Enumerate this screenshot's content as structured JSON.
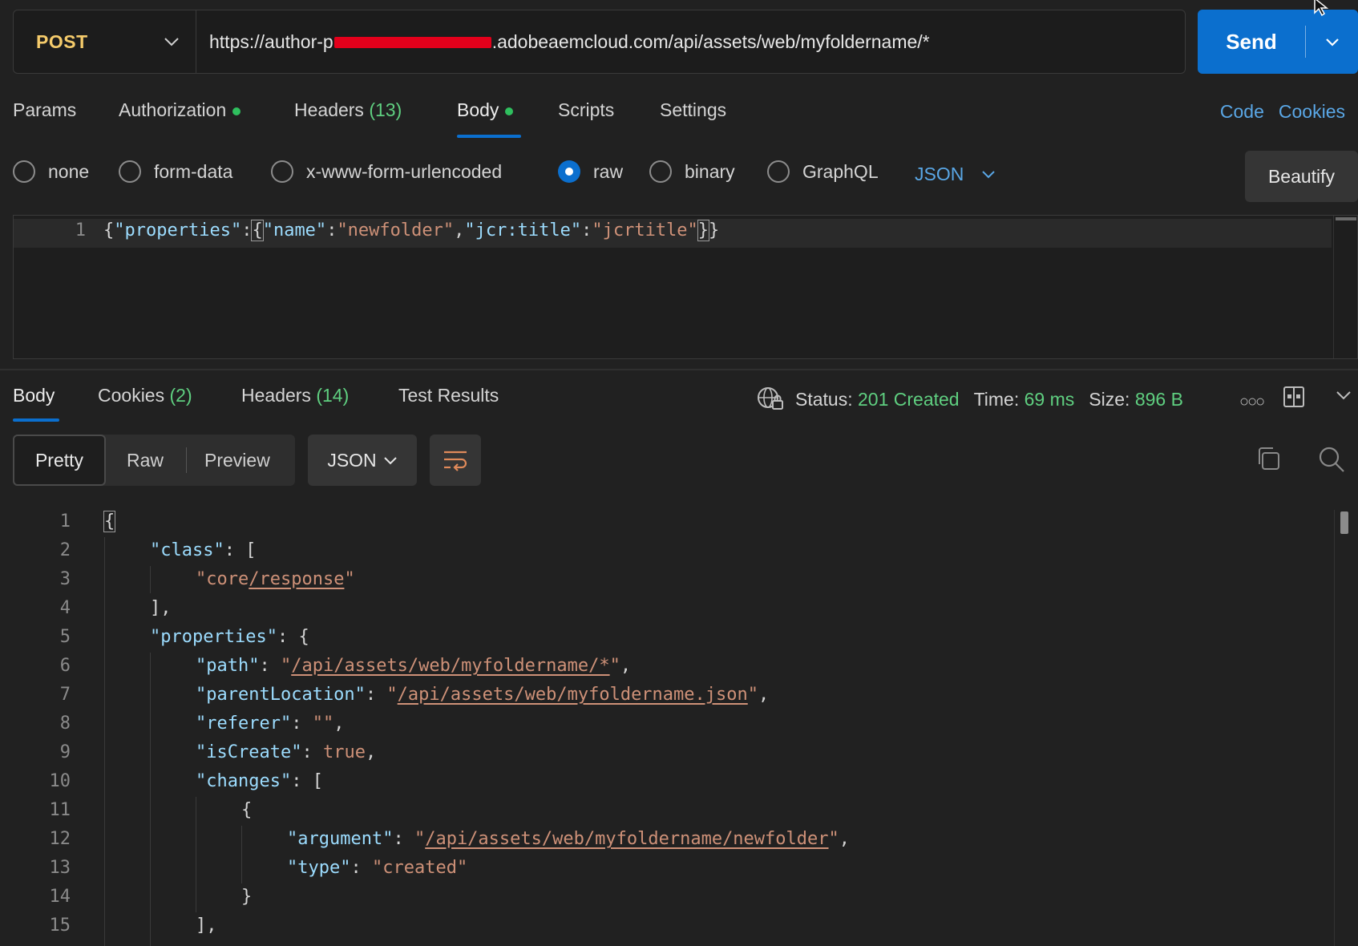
{
  "request": {
    "method": "POST",
    "url_prefix": "https://author-p",
    "url_suffix": ".adobeaemcloud.com/api/assets/web/myfoldername/*",
    "send_label": "Send"
  },
  "request_tabs": {
    "params": "Params",
    "authorization": "Authorization",
    "headers": "Headers",
    "headers_count": "(13)",
    "body": "Body",
    "scripts": "Scripts",
    "settings": "Settings",
    "code": "Code",
    "cookies": "Cookies"
  },
  "body_types": {
    "options": [
      "none",
      "form-data",
      "x-www-form-urlencoded",
      "raw",
      "binary",
      "GraphQL"
    ],
    "selected": "raw",
    "language": "JSON",
    "beautify": "Beautify"
  },
  "request_body": {
    "line_number": "1",
    "p1": "{",
    "k1": "\"properties\"",
    "p2": ":",
    "p3": "{",
    "k2": "\"name\"",
    "p4": ":",
    "s1": "\"newfolder\"",
    "p5": ",",
    "k3": "\"jcr:title\"",
    "p6": ":",
    "s2": "\"jcrtitle\"",
    "p7": "}",
    "p8": "}"
  },
  "response_tabs": {
    "body": "Body",
    "cookies": "Cookies",
    "cookies_count": "(2)",
    "headers": "Headers",
    "headers_count": "(14)",
    "test_results": "Test Results"
  },
  "response_status": {
    "status_label": "Status:",
    "status_value": "201 Created",
    "time_label": "Time:",
    "time_value": "69 ms",
    "size_label": "Size:",
    "size_value": "896 B"
  },
  "response_toolbar": {
    "pretty": "Pretty",
    "raw": "Raw",
    "preview": "Preview",
    "format": "JSON"
  },
  "response_body": {
    "line_numbers": [
      "1",
      "2",
      "3",
      "4",
      "5",
      "6",
      "7",
      "8",
      "9",
      "10",
      "11",
      "12",
      "13",
      "14",
      "15"
    ],
    "l1": "{",
    "l2_key": "\"class\"",
    "l2_rest": ": [",
    "l3_q1": "\"core",
    "l3_link": "/response",
    "l3_q2": "\"",
    "l4": "],",
    "l5_key": "\"properties\"",
    "l5_rest": ": {",
    "l6_key": "\"path\"",
    "l6_sep": ": ",
    "l6_q1": "\"",
    "l6_link": "/api/assets/web/myfoldername/*",
    "l6_q2": "\"",
    "l6_end": ",",
    "l7_key": "\"parentLocation\"",
    "l7_sep": ": ",
    "l7_q1": "\"",
    "l7_link": "/api/assets/web/myfoldername.json",
    "l7_q2": "\"",
    "l7_end": ",",
    "l8_key": "\"referer\"",
    "l8_sep": ": ",
    "l8_val": "\"\"",
    "l8_end": ",",
    "l9_key": "\"isCreate\"",
    "l9_sep": ": ",
    "l9_val": "true",
    "l9_end": ",",
    "l10_key": "\"changes\"",
    "l10_rest": ": [",
    "l11": "{",
    "l12_key": "\"argument\"",
    "l12_sep": ": ",
    "l12_q1": "\"",
    "l12_link": "/api/assets/web/myfoldername/newfolder",
    "l12_q2": "\"",
    "l12_end": ",",
    "l13_key": "\"type\"",
    "l13_sep": ": ",
    "l13_val": "\"created\"",
    "l14": "}",
    "l15": "],"
  },
  "colors": {
    "accent": "#0b6fce",
    "method": "#f5cb6b",
    "success": "#5fcf80",
    "link": "#5aa7e6",
    "json_key": "#9cdcfe",
    "json_string": "#ce9178",
    "redaction": "#e3001b"
  },
  "icons": [
    "chevron-down-icon",
    "caret-down-icon",
    "mouse-cursor-icon",
    "globe-lock-icon",
    "more-icon",
    "split-layout-icon",
    "collapse-chevron-icon",
    "wrap-lines-icon",
    "copy-icon",
    "search-icon"
  ]
}
